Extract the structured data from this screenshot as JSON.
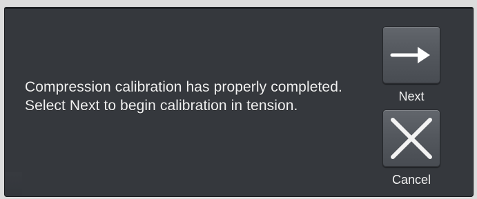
{
  "dialog": {
    "message": "Compression calibration has properly completed. Select Next to begin calibration in tension."
  },
  "buttons": {
    "next": {
      "label": "Next",
      "icon": "arrow-right-icon"
    },
    "cancel": {
      "label": "Cancel",
      "icon": "close-icon"
    }
  },
  "colors": {
    "dialog_background": "#35383d",
    "button_background": "#55595f",
    "text": "#f1f1f1",
    "page_background": "#dcdcdc"
  }
}
